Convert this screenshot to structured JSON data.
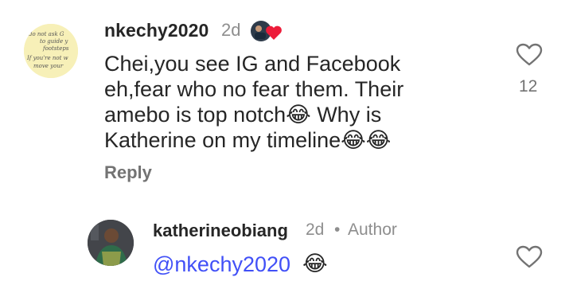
{
  "comment": {
    "username": "nkechy2020",
    "time": "2d",
    "text": "Chei,you see IG and Facebook eh,fear who no fear them. Their amebo is top notch😂 Why is Katherine on my timeline😂😂",
    "reply_label": "Reply",
    "like_count": "12",
    "avatar_text": [
      "do not ask G",
      "to guide y",
      "footsteps",
      "If you're not w",
      "move your"
    ]
  },
  "reply": {
    "username": "katherineobiang",
    "time": "2d",
    "separator": "•",
    "badge": "Author",
    "mention": "@nkechy2020",
    "emoji": "😂"
  },
  "icons": {
    "like": "heart-outline-icon",
    "flair": "avatar-heart-flair-icon"
  },
  "colors": {
    "mention": "#4150f7",
    "secondary_text": "#8e8e8e",
    "flair_heart": "#ed1c3a"
  }
}
